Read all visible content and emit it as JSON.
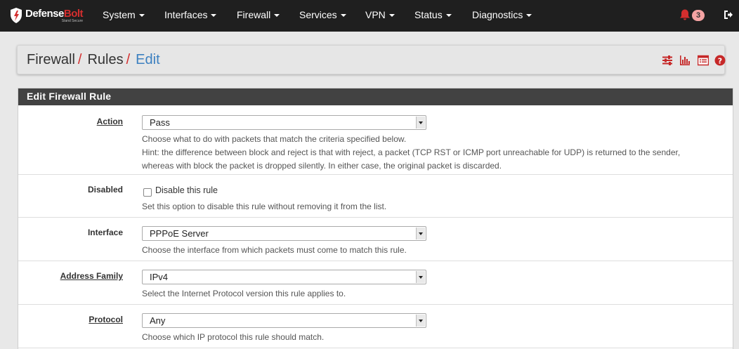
{
  "navbar": {
    "brand": {
      "name_part1": "Defense",
      "name_part2": "Bolt",
      "tagline": "Stand Secure"
    },
    "menus": [
      {
        "label": "System"
      },
      {
        "label": "Interfaces"
      },
      {
        "label": "Firewall"
      },
      {
        "label": "Services"
      },
      {
        "label": "VPN"
      },
      {
        "label": "Status"
      },
      {
        "label": "Diagnostics"
      }
    ],
    "notification_count": "3",
    "icons": {
      "notifications": "bell-icon",
      "logout": "sign-out-icon"
    },
    "accent_color": "#d42e2e"
  },
  "breadcrumb": {
    "items": [
      "Firewall",
      "Rules",
      "Edit"
    ],
    "separator": "/",
    "toolbar_icons": [
      "sliders-icon",
      "bar-chart-icon",
      "list-icon",
      "help-icon"
    ]
  },
  "panel": {
    "title": "Edit Firewall Rule",
    "fields": {
      "action": {
        "label": "Action",
        "value": "Pass",
        "help": [
          "Choose what to do with packets that match the criteria specified below.",
          "Hint: the difference between block and reject is that with reject, a packet (TCP RST or ICMP port unreachable for UDP) is returned to the sender,",
          "whereas with block the packet is dropped silently. In either case, the original packet is discarded."
        ]
      },
      "disabled": {
        "label": "Disabled",
        "checkbox_label": "Disable this rule",
        "checked": false,
        "help": "Set this option to disable this rule without removing it from the list."
      },
      "interface": {
        "label": "Interface",
        "value": "PPPoE Server",
        "help": "Choose the interface from which packets must come to match this rule."
      },
      "address_family": {
        "label": "Address Family",
        "value": "IPv4",
        "help": "Select the Internet Protocol version this rule applies to."
      },
      "protocol": {
        "label": "Protocol",
        "value": "Any",
        "help": "Choose which IP protocol this rule should match."
      }
    }
  }
}
